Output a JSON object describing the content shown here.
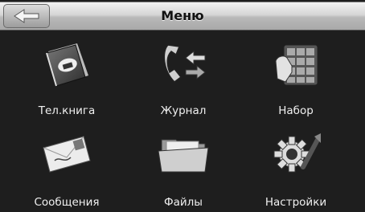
{
  "header": {
    "title": "Меню",
    "back_icon": "back-arrow-icon"
  },
  "menu": {
    "items": [
      {
        "label": "Тел.книга",
        "icon": "phonebook-icon"
      },
      {
        "label": "Журнал",
        "icon": "call-log-icon"
      },
      {
        "label": "Набор",
        "icon": "dialpad-icon"
      },
      {
        "label": "Сообщения",
        "icon": "messages-icon"
      },
      {
        "label": "Файлы",
        "icon": "files-folder-icon"
      },
      {
        "label": "Настройки",
        "icon": "settings-gear-icon"
      }
    ]
  },
  "colors": {
    "background": "#1e1e1e",
    "header": "#d0d0d0",
    "label_text": "#f0f0f0"
  }
}
